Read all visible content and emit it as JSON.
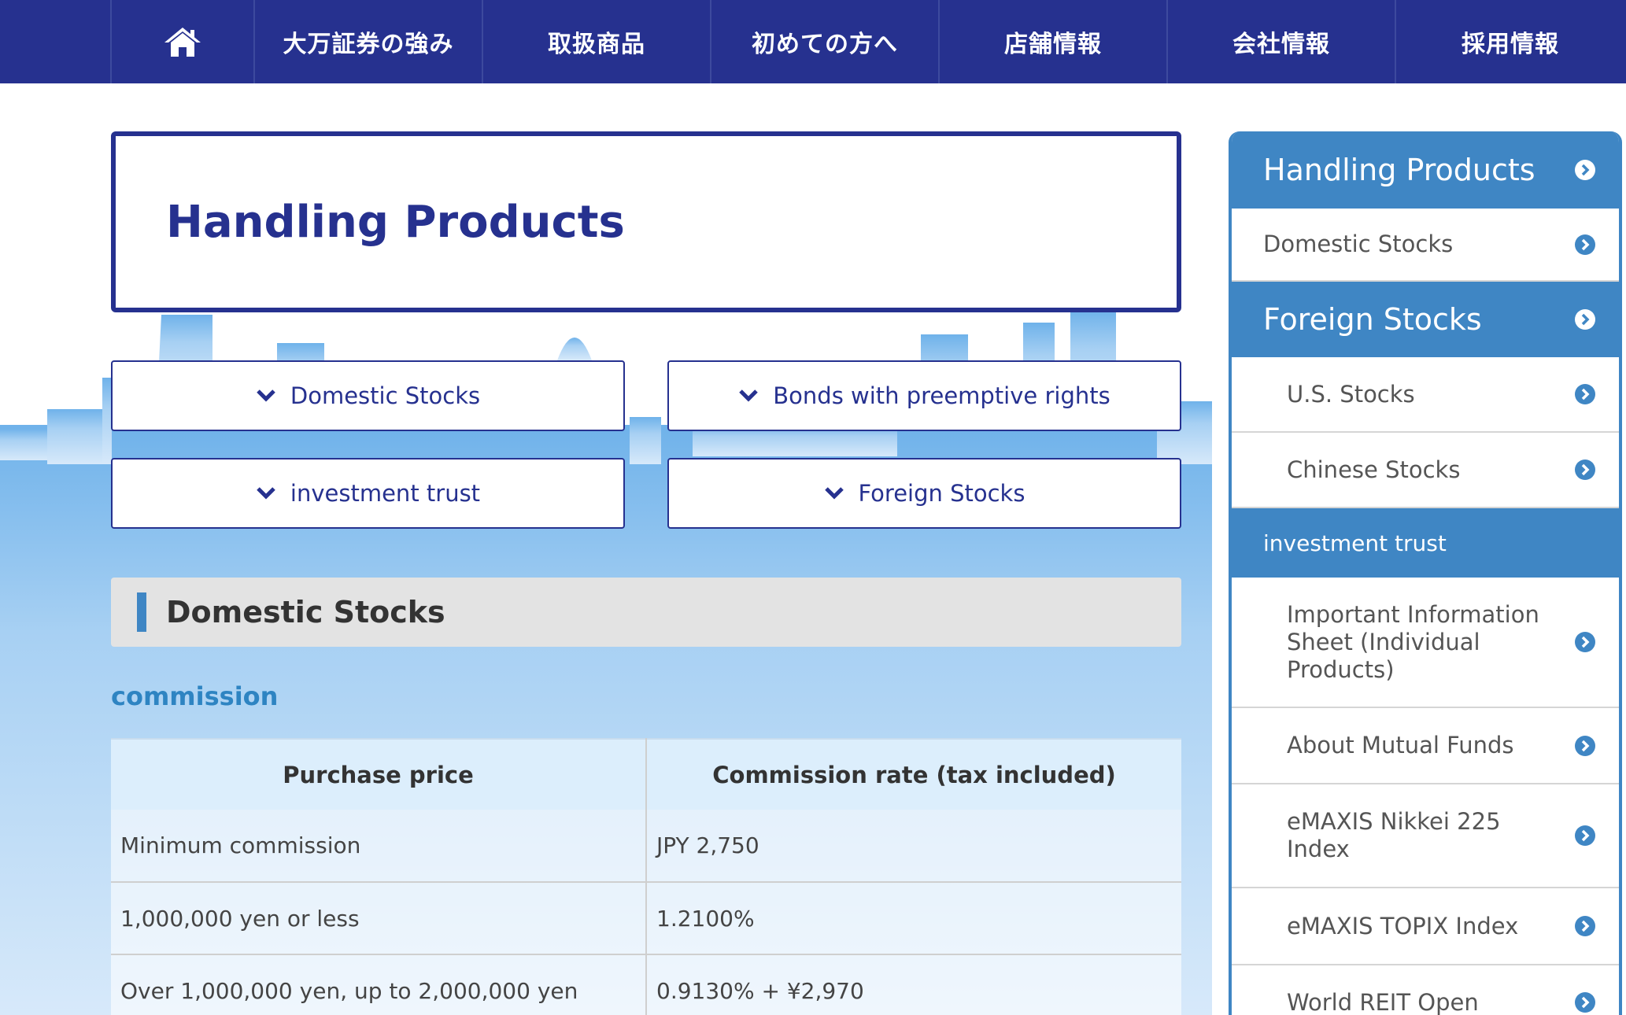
{
  "nav": {
    "home_icon": "home-icon",
    "items": [
      "大万証券の強み",
      "取扱商品",
      "初めての方へ",
      "店舗情報",
      "会社情報",
      "採用情報"
    ]
  },
  "page": {
    "title": "Handling Products",
    "anchors": [
      "Domestic Stocks",
      "Bonds with preemptive rights",
      "investment trust",
      "Foreign Stocks"
    ],
    "section_title": "Domestic Stocks",
    "subheading": "commission",
    "table": {
      "headers": [
        "Purchase price",
        "Commission rate (tax included)"
      ],
      "rows": [
        [
          "Minimum commission",
          "JPY 2,750"
        ],
        [
          "1,000,000 yen or less",
          "1.2100%"
        ],
        [
          "Over 1,000,000 yen, up to 2,000,000 yen",
          "0.9130% + ¥2,970"
        ]
      ]
    }
  },
  "sidebar": {
    "items": [
      {
        "label": "Handling Products",
        "kind": "head"
      },
      {
        "label": "Domestic Stocks",
        "kind": "item"
      },
      {
        "label": "Foreign Stocks",
        "kind": "head"
      },
      {
        "label": "U.S. Stocks",
        "kind": "sub"
      },
      {
        "label": "Chinese Stocks",
        "kind": "sub"
      },
      {
        "label": "investment trust",
        "kind": "cat"
      },
      {
        "label": "Important Information Sheet (Individual Products)",
        "kind": "sub"
      },
      {
        "label": "About Mutual Funds",
        "kind": "sub"
      },
      {
        "label": "eMAXIS Nikkei 225 Index",
        "kind": "sub"
      },
      {
        "label": "eMAXIS TOPIX Index",
        "kind": "sub"
      },
      {
        "label": "World REIT Open",
        "kind": "sub"
      }
    ]
  },
  "colors": {
    "nav_bg": "#26318f",
    "accent_blue": "#3f86c4",
    "title_blue": "#26318f",
    "table_header_bg": "#dceefc"
  }
}
